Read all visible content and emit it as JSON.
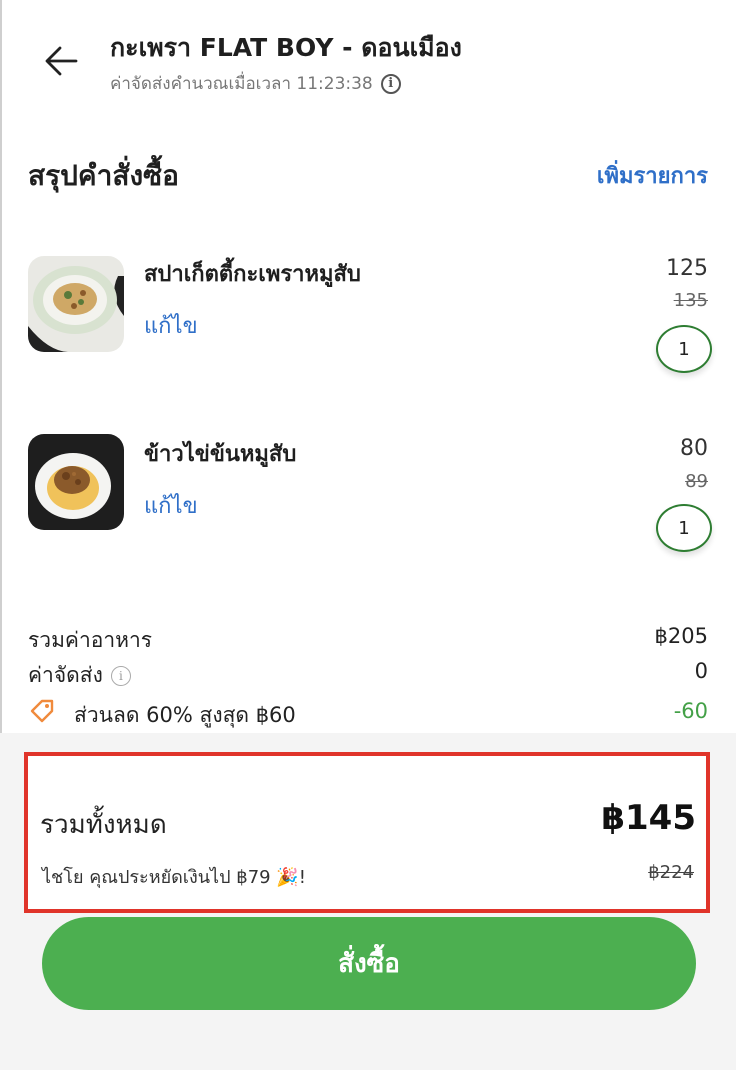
{
  "header": {
    "title": "กะเพรา FLAT BOY - ดอนเมือง",
    "subtitle": "ค่าจัดส่งคำนวณเมื่อเวลา 11:23:38",
    "info_icon": "i"
  },
  "section": {
    "title": "สรุปคำสั่งซื้อ",
    "add_label": "เพิ่มรายการ"
  },
  "items": [
    {
      "name": "สปาเก็ตตี้กะเพราหมูสับ",
      "edit": "แก้ไข",
      "price": "125",
      "old_price": "135",
      "qty": "1"
    },
    {
      "name": "ข้าวไข่ข้นหมูสับ",
      "edit": "แก้ไข",
      "price": "80",
      "old_price": "89",
      "qty": "1"
    }
  ],
  "summary": {
    "food_label": "รวมค่าอาหาร",
    "food_value": "฿205",
    "delivery_label": "ค่าจัดส่ง",
    "delivery_info": "i",
    "delivery_value": "0",
    "discount_label": "ส่วนลด 60% สูงสุด ฿60",
    "discount_value": "-60"
  },
  "total": {
    "label": "รวมทั้งหมด",
    "amount": "฿145",
    "savings": "ไชโย คุณประหยัดเงินไป  ฿79 🎉!",
    "old_total": "฿224"
  },
  "order_button": "สั่งซื้อ",
  "colors": {
    "link_blue": "#2f6fc8",
    "accent_green": "#4caf50",
    "highlight_red": "#e0342a",
    "discount_orange": "#f08a3c"
  },
  "icons": {
    "back": "arrow-left-icon",
    "tag": "tag-icon",
    "info": "info-icon"
  }
}
